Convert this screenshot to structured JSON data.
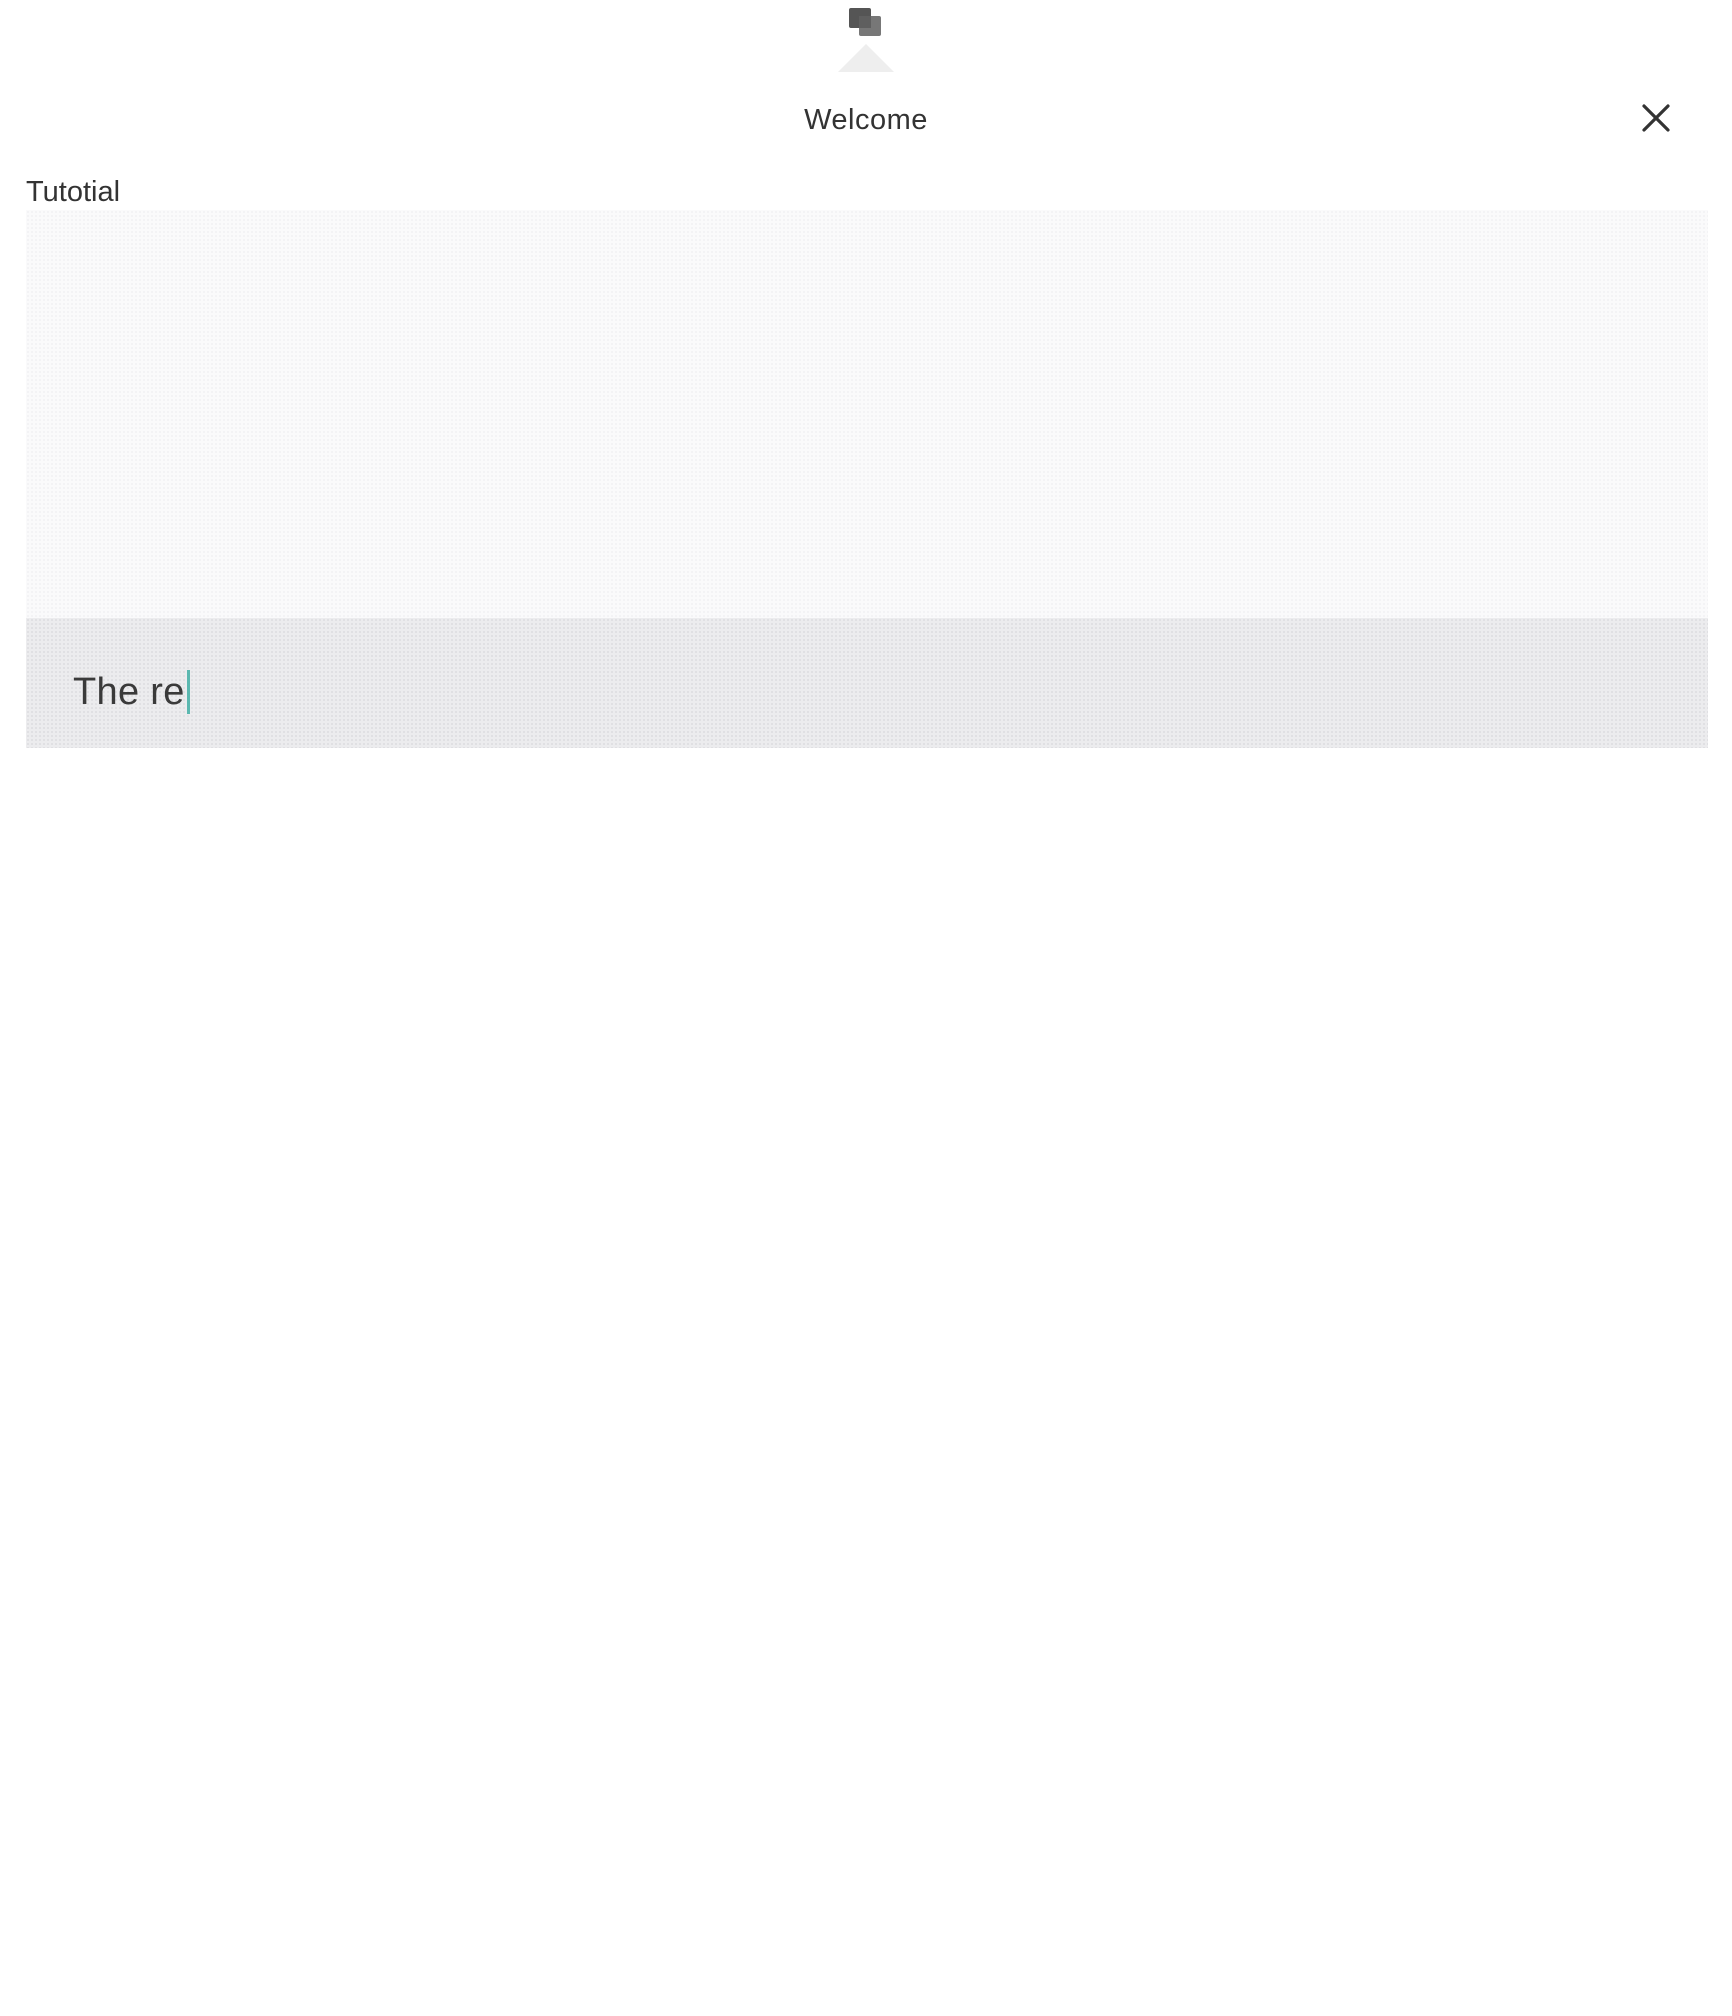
{
  "header": {
    "title": "Welcome",
    "top_icon": "stacked-squares-icon",
    "close_icon": "close-icon"
  },
  "tutorial": {
    "label": "Tutotial",
    "typed_text": "The re",
    "caret_color": "#5bb8b0"
  }
}
